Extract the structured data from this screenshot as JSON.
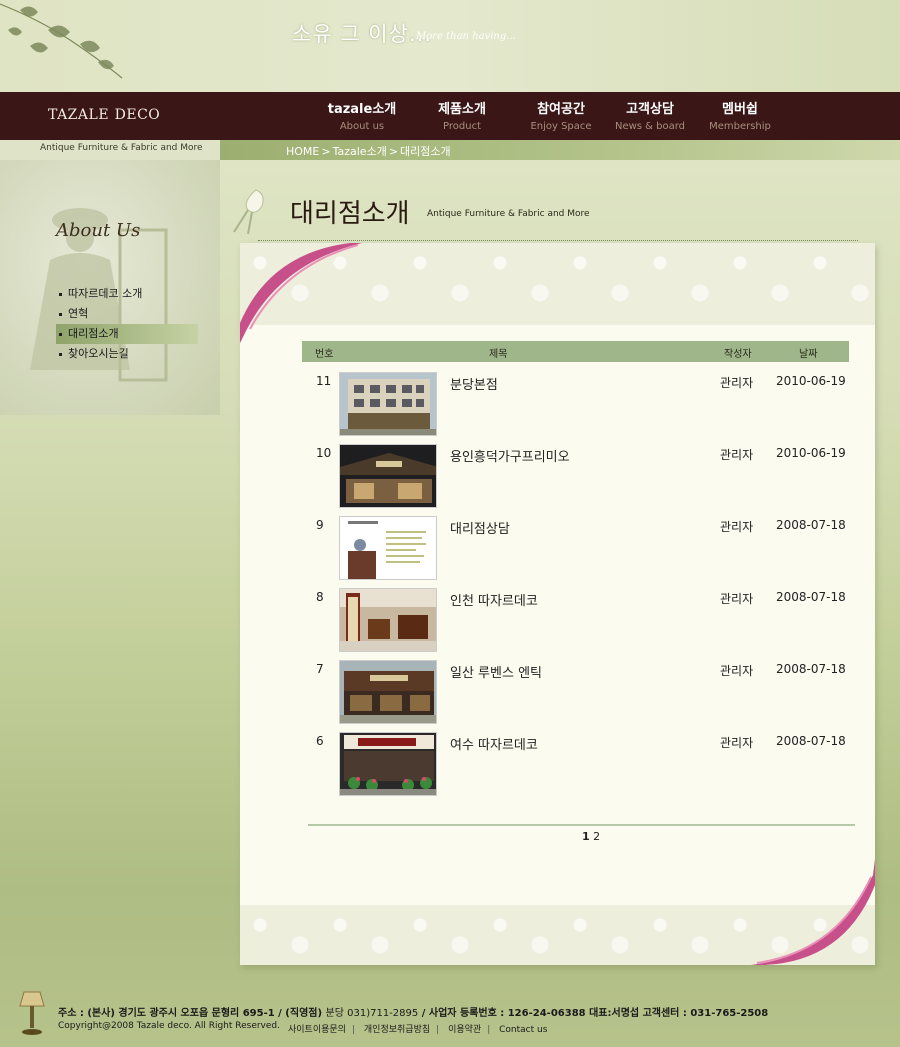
{
  "header": {
    "slogan": "소유 그 이상...",
    "slogan_sub": "More than having..."
  },
  "logo": {
    "main": "TAZALE",
    "sub": "DECO"
  },
  "nav": [
    {
      "ko": "tazale소개",
      "en": "About us"
    },
    {
      "ko": "제품소개",
      "en": "Product"
    },
    {
      "ko": "참여공간",
      "en": "Enjoy Space"
    },
    {
      "ko": "고객상담",
      "en": "News & board"
    },
    {
      "ko": "멤버쉽",
      "en": "Membership"
    }
  ],
  "tagline": "Antique Furniture  & Fabric and More",
  "breadcrumb": [
    "HOME",
    "Tazale소개",
    "대리점소개"
  ],
  "sidebar": {
    "title": "About Us",
    "items": [
      {
        "label": "따자르데코 소개",
        "active": false
      },
      {
        "label": "연혁",
        "active": false
      },
      {
        "label": "대리점소개",
        "active": true
      },
      {
        "label": "찾아오시는길",
        "active": false
      }
    ]
  },
  "page": {
    "title": "대리점소개",
    "subtitle": "Antique Furniture  & Fabric and More"
  },
  "table": {
    "headers": {
      "num": "번호",
      "subject": "제목",
      "author": "작성자",
      "date": "날짜"
    },
    "rows": [
      {
        "num": "11",
        "subject": "분당본점",
        "author": "관리자",
        "date": "2010-06-19",
        "thumb": "building"
      },
      {
        "num": "10",
        "subject": "용인흥덕가구프리미오",
        "author": "관리자",
        "date": "2010-06-19",
        "thumb": "storefront-dark"
      },
      {
        "num": "9",
        "subject": "대리점상담",
        "author": "관리자",
        "date": "2008-07-18",
        "thumb": "document"
      },
      {
        "num": "8",
        "subject": "인천 따자르데코",
        "author": "관리자",
        "date": "2008-07-18",
        "thumb": "interior"
      },
      {
        "num": "7",
        "subject": "일산 루벤스 엔틱",
        "author": "관리자",
        "date": "2008-07-18",
        "thumb": "storefront-brown"
      },
      {
        "num": "6",
        "subject": "여수 따자르데코",
        "author": "관리자",
        "date": "2008-07-18",
        "thumb": "storefront-flowers"
      }
    ]
  },
  "pager": {
    "current": "1",
    "other": "2"
  },
  "footer": {
    "addr_label": "주소 : (본사) 경기도 광주시  오포읍 문형리 695-1  /  (직영점)",
    "addr_branch": "분당 031)711-2895",
    "addr_rest": "  /  사업자 등록번호 : 126-24-06388   대표:서명섭  고객센터 : 031-765-2508",
    "copyright": "Copyright@2008 Tazale deco. All  Right Reserved.",
    "links": [
      "사이트이용문의",
      "개인정보취급방침",
      "이용약관",
      "Contact us"
    ]
  }
}
